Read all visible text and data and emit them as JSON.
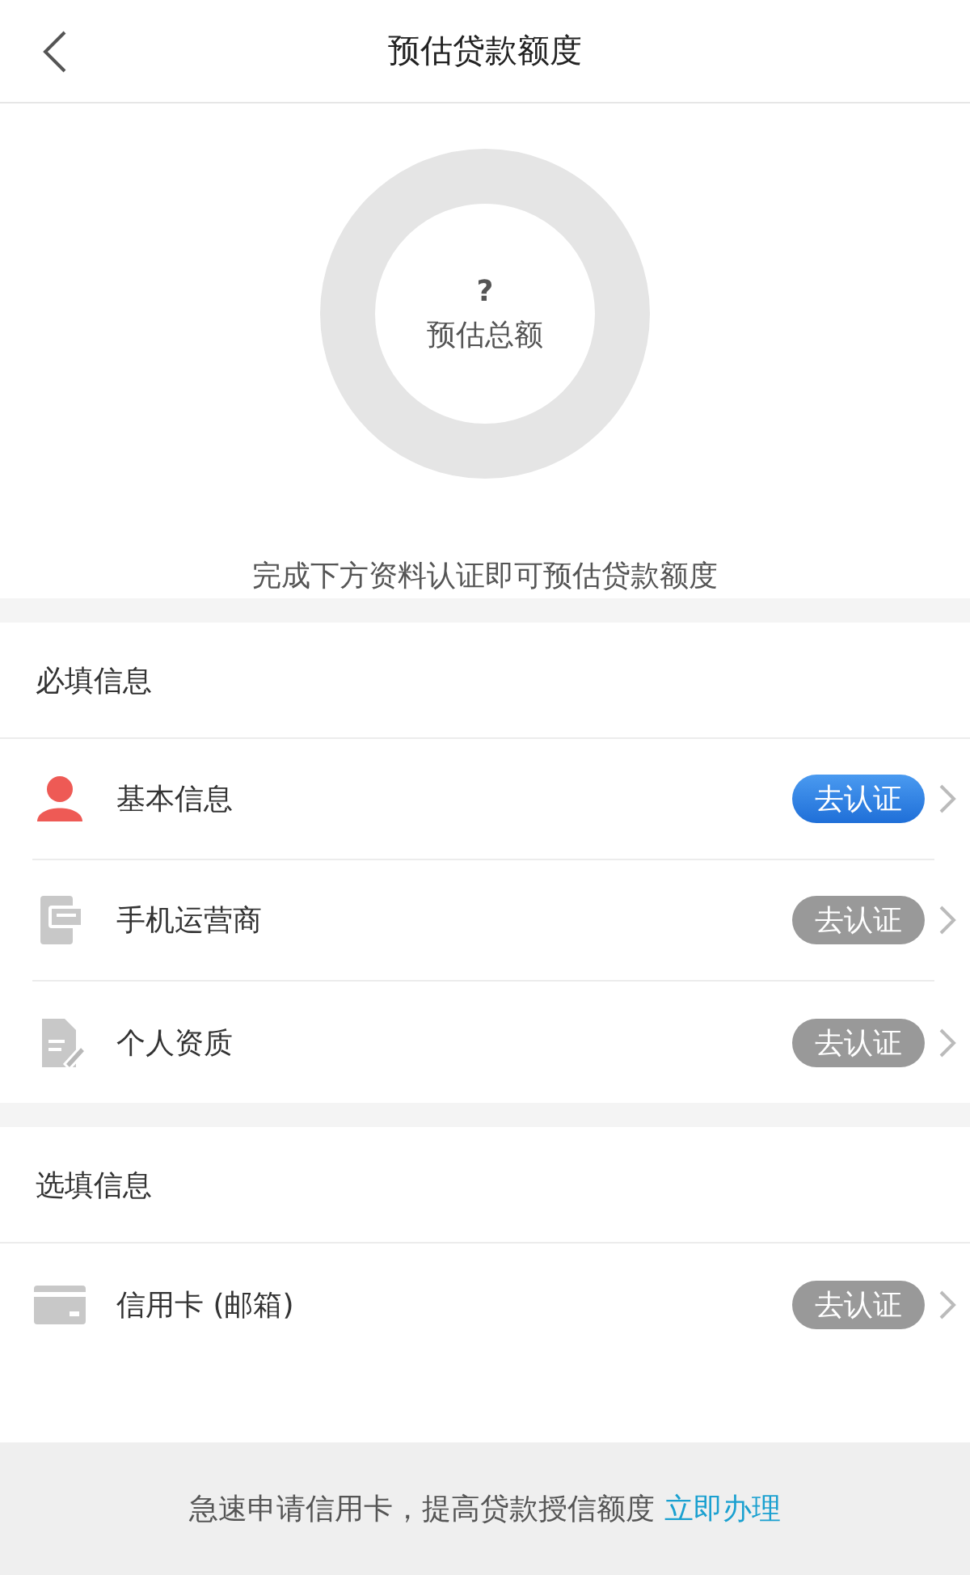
{
  "header": {
    "title": "预估贷款额度"
  },
  "estimate": {
    "value": "?",
    "label": "预估总额",
    "hint": "完成下方资料认证即可预估贷款额度"
  },
  "sections": [
    {
      "title": "必填信息",
      "items": [
        {
          "kind": "person",
          "label": "基本信息",
          "action": "去认证",
          "active": true
        },
        {
          "kind": "phone",
          "label": "手机运营商",
          "action": "去认证",
          "active": false
        },
        {
          "kind": "document",
          "label": "个人资质",
          "action": "去认证",
          "active": false
        }
      ]
    },
    {
      "title": "选填信息",
      "items": [
        {
          "kind": "card",
          "label": "信用卡 (邮箱)",
          "action": "去认证",
          "active": false
        }
      ]
    }
  ],
  "footer": {
    "text": "急速申请信用卡，提高贷款授信额度",
    "link": "立即办理"
  }
}
